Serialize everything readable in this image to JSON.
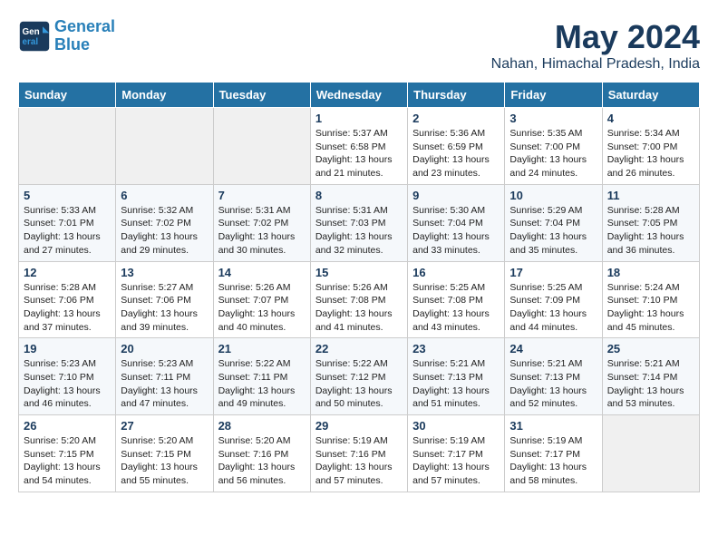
{
  "header": {
    "logo_line1": "General",
    "logo_line2": "Blue",
    "month_title": "May 2024",
    "subtitle": "Nahan, Himachal Pradesh, India"
  },
  "weekdays": [
    "Sunday",
    "Monday",
    "Tuesday",
    "Wednesday",
    "Thursday",
    "Friday",
    "Saturday"
  ],
  "weeks": [
    [
      {
        "day": "",
        "sunrise": "",
        "sunset": "",
        "daylight": ""
      },
      {
        "day": "",
        "sunrise": "",
        "sunset": "",
        "daylight": ""
      },
      {
        "day": "",
        "sunrise": "",
        "sunset": "",
        "daylight": ""
      },
      {
        "day": "1",
        "sunrise": "Sunrise: 5:37 AM",
        "sunset": "Sunset: 6:58 PM",
        "daylight": "Daylight: 13 hours and 21 minutes."
      },
      {
        "day": "2",
        "sunrise": "Sunrise: 5:36 AM",
        "sunset": "Sunset: 6:59 PM",
        "daylight": "Daylight: 13 hours and 23 minutes."
      },
      {
        "day": "3",
        "sunrise": "Sunrise: 5:35 AM",
        "sunset": "Sunset: 7:00 PM",
        "daylight": "Daylight: 13 hours and 24 minutes."
      },
      {
        "day": "4",
        "sunrise": "Sunrise: 5:34 AM",
        "sunset": "Sunset: 7:00 PM",
        "daylight": "Daylight: 13 hours and 26 minutes."
      }
    ],
    [
      {
        "day": "5",
        "sunrise": "Sunrise: 5:33 AM",
        "sunset": "Sunset: 7:01 PM",
        "daylight": "Daylight: 13 hours and 27 minutes."
      },
      {
        "day": "6",
        "sunrise": "Sunrise: 5:32 AM",
        "sunset": "Sunset: 7:02 PM",
        "daylight": "Daylight: 13 hours and 29 minutes."
      },
      {
        "day": "7",
        "sunrise": "Sunrise: 5:31 AM",
        "sunset": "Sunset: 7:02 PM",
        "daylight": "Daylight: 13 hours and 30 minutes."
      },
      {
        "day": "8",
        "sunrise": "Sunrise: 5:31 AM",
        "sunset": "Sunset: 7:03 PM",
        "daylight": "Daylight: 13 hours and 32 minutes."
      },
      {
        "day": "9",
        "sunrise": "Sunrise: 5:30 AM",
        "sunset": "Sunset: 7:04 PM",
        "daylight": "Daylight: 13 hours and 33 minutes."
      },
      {
        "day": "10",
        "sunrise": "Sunrise: 5:29 AM",
        "sunset": "Sunset: 7:04 PM",
        "daylight": "Daylight: 13 hours and 35 minutes."
      },
      {
        "day": "11",
        "sunrise": "Sunrise: 5:28 AM",
        "sunset": "Sunset: 7:05 PM",
        "daylight": "Daylight: 13 hours and 36 minutes."
      }
    ],
    [
      {
        "day": "12",
        "sunrise": "Sunrise: 5:28 AM",
        "sunset": "Sunset: 7:06 PM",
        "daylight": "Daylight: 13 hours and 37 minutes."
      },
      {
        "day": "13",
        "sunrise": "Sunrise: 5:27 AM",
        "sunset": "Sunset: 7:06 PM",
        "daylight": "Daylight: 13 hours and 39 minutes."
      },
      {
        "day": "14",
        "sunrise": "Sunrise: 5:26 AM",
        "sunset": "Sunset: 7:07 PM",
        "daylight": "Daylight: 13 hours and 40 minutes."
      },
      {
        "day": "15",
        "sunrise": "Sunrise: 5:26 AM",
        "sunset": "Sunset: 7:08 PM",
        "daylight": "Daylight: 13 hours and 41 minutes."
      },
      {
        "day": "16",
        "sunrise": "Sunrise: 5:25 AM",
        "sunset": "Sunset: 7:08 PM",
        "daylight": "Daylight: 13 hours and 43 minutes."
      },
      {
        "day": "17",
        "sunrise": "Sunrise: 5:25 AM",
        "sunset": "Sunset: 7:09 PM",
        "daylight": "Daylight: 13 hours and 44 minutes."
      },
      {
        "day": "18",
        "sunrise": "Sunrise: 5:24 AM",
        "sunset": "Sunset: 7:10 PM",
        "daylight": "Daylight: 13 hours and 45 minutes."
      }
    ],
    [
      {
        "day": "19",
        "sunrise": "Sunrise: 5:23 AM",
        "sunset": "Sunset: 7:10 PM",
        "daylight": "Daylight: 13 hours and 46 minutes."
      },
      {
        "day": "20",
        "sunrise": "Sunrise: 5:23 AM",
        "sunset": "Sunset: 7:11 PM",
        "daylight": "Daylight: 13 hours and 47 minutes."
      },
      {
        "day": "21",
        "sunrise": "Sunrise: 5:22 AM",
        "sunset": "Sunset: 7:11 PM",
        "daylight": "Daylight: 13 hours and 49 minutes."
      },
      {
        "day": "22",
        "sunrise": "Sunrise: 5:22 AM",
        "sunset": "Sunset: 7:12 PM",
        "daylight": "Daylight: 13 hours and 50 minutes."
      },
      {
        "day": "23",
        "sunrise": "Sunrise: 5:21 AM",
        "sunset": "Sunset: 7:13 PM",
        "daylight": "Daylight: 13 hours and 51 minutes."
      },
      {
        "day": "24",
        "sunrise": "Sunrise: 5:21 AM",
        "sunset": "Sunset: 7:13 PM",
        "daylight": "Daylight: 13 hours and 52 minutes."
      },
      {
        "day": "25",
        "sunrise": "Sunrise: 5:21 AM",
        "sunset": "Sunset: 7:14 PM",
        "daylight": "Daylight: 13 hours and 53 minutes."
      }
    ],
    [
      {
        "day": "26",
        "sunrise": "Sunrise: 5:20 AM",
        "sunset": "Sunset: 7:15 PM",
        "daylight": "Daylight: 13 hours and 54 minutes."
      },
      {
        "day": "27",
        "sunrise": "Sunrise: 5:20 AM",
        "sunset": "Sunset: 7:15 PM",
        "daylight": "Daylight: 13 hours and 55 minutes."
      },
      {
        "day": "28",
        "sunrise": "Sunrise: 5:20 AM",
        "sunset": "Sunset: 7:16 PM",
        "daylight": "Daylight: 13 hours and 56 minutes."
      },
      {
        "day": "29",
        "sunrise": "Sunrise: 5:19 AM",
        "sunset": "Sunset: 7:16 PM",
        "daylight": "Daylight: 13 hours and 57 minutes."
      },
      {
        "day": "30",
        "sunrise": "Sunrise: 5:19 AM",
        "sunset": "Sunset: 7:17 PM",
        "daylight": "Daylight: 13 hours and 57 minutes."
      },
      {
        "day": "31",
        "sunrise": "Sunrise: 5:19 AM",
        "sunset": "Sunset: 7:17 PM",
        "daylight": "Daylight: 13 hours and 58 minutes."
      },
      {
        "day": "",
        "sunrise": "",
        "sunset": "",
        "daylight": ""
      }
    ]
  ]
}
